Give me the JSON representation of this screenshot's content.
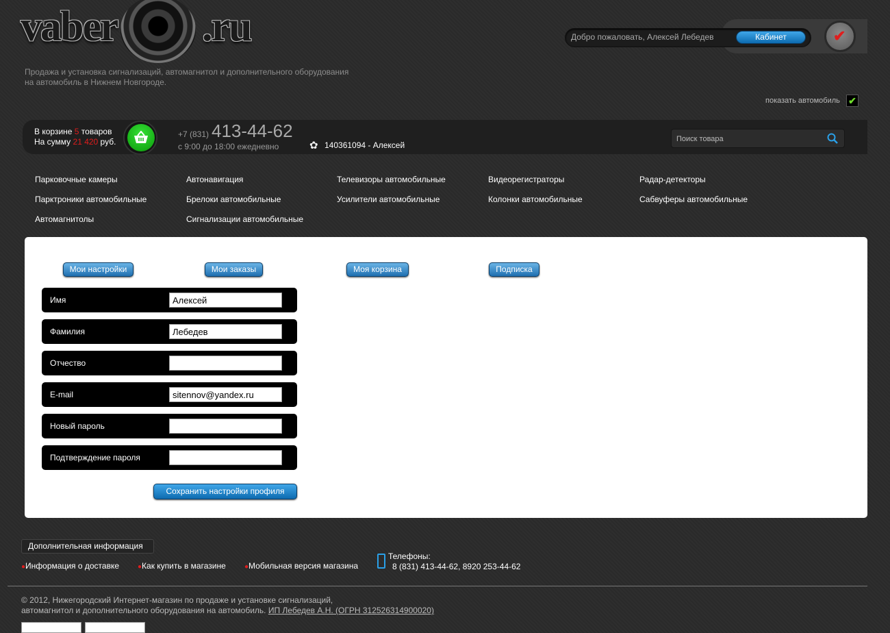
{
  "logo": {
    "left": "vaber",
    "right": ".ru"
  },
  "tagline": [
    "Продажа и установка сигнализаций, автомагнитол и дополнительного оборудования",
    "на автомобиль в Нижнем Новгороде."
  ],
  "welcome": {
    "text": "Добро пожаловать, Алексей Лебедев",
    "cabinet_button": "Кабинет"
  },
  "show_car": {
    "label": "показать автомобиль",
    "checked": "✔"
  },
  "cart": {
    "line1_prefix": "В корзине ",
    "count": "5",
    "line1_suffix": " товаров",
    "line2_prefix": "На сумму ",
    "sum": "21 420",
    "line2_suffix": " руб."
  },
  "contact": {
    "phone_prefix": "+7 (831)",
    "phone_main": "413-44-62",
    "hours": "с 9:00 до 18:00 ежедневно",
    "icq": "140361094 - Алексей"
  },
  "search": {
    "placeholder": "Поиск товара"
  },
  "categories": [
    [
      "Парковочные камеры",
      "Автонавигация",
      "Телевизоры автомобильные",
      "Видеорегистраторы",
      "Радар-детекторы"
    ],
    [
      "Парктроники автомобильные",
      "Брелоки автомобильные",
      "Усилители автомобильные",
      "Колонки автомобильные",
      "Сабвуферы автомобильные"
    ],
    [
      "Автомагнитолы",
      "Сигнализации автомобильные"
    ]
  ],
  "tabs": [
    "Мои настройки",
    "Мои заказы",
    "Моя корзина",
    "Подписка"
  ],
  "form": {
    "fields": [
      {
        "label": "Имя",
        "value": "Алексей"
      },
      {
        "label": "Фамилия",
        "value": "Лебедев"
      },
      {
        "label": "Отчество",
        "value": ""
      },
      {
        "label": "E-mail",
        "value": "sitennov@yandex.ru"
      },
      {
        "label": "Новый пароль",
        "value": ""
      },
      {
        "label": "Подтверждение пароля",
        "value": ""
      }
    ],
    "save_button": "Сохранить настройки профиля"
  },
  "footer": {
    "additional": "Дополнительная информация",
    "links": [
      "Информация о доставке",
      "Как купить в магазине",
      "Мобильная версия магазина"
    ],
    "phones_label": "Телефоны:",
    "phones_value": "8 (831) 413-44-62, 8920 253-44-62",
    "copyright_line1": "© 2012, Нижегородский Интернет-магазин по продаже и установке сигнализаций,",
    "copyright_line2": "автомагнитол и дополнительного оборудования на автомобиль. ",
    "copyright_link": "ИП Лебедев А.Н. (ОГРН 312526314900020)"
  }
}
